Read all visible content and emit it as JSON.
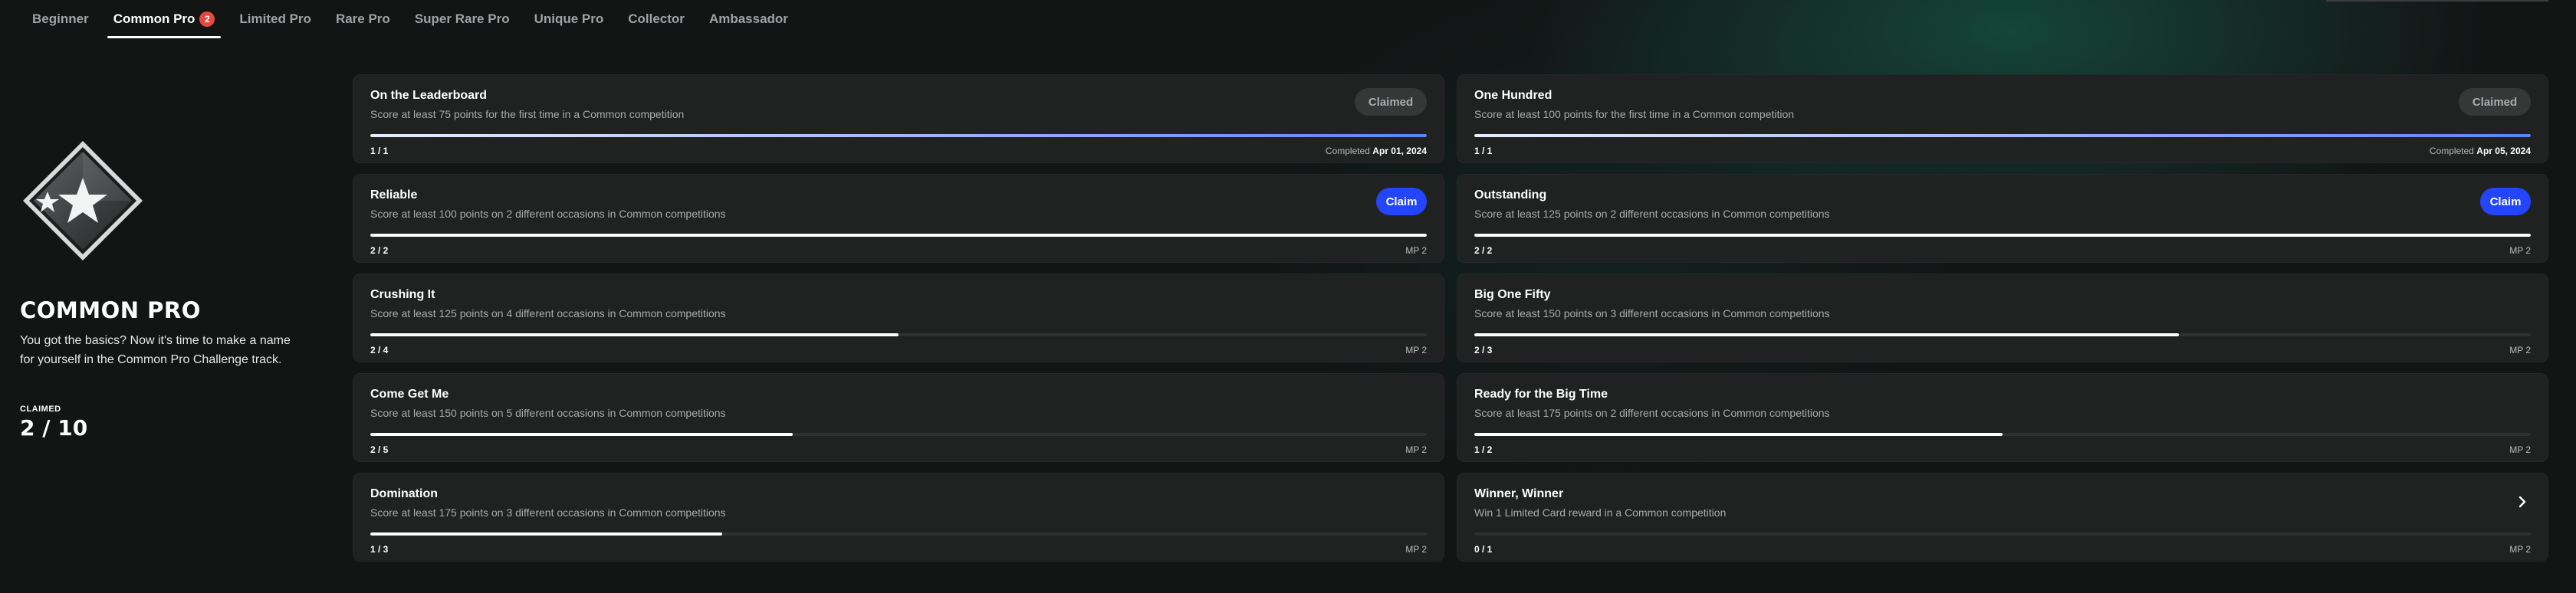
{
  "tabs": [
    {
      "label": "Beginner"
    },
    {
      "label": "Common Pro",
      "badge": "2",
      "active": true
    },
    {
      "label": "Limited Pro"
    },
    {
      "label": "Rare Pro"
    },
    {
      "label": "Super Rare Pro"
    },
    {
      "label": "Unique Pro"
    },
    {
      "label": "Collector"
    },
    {
      "label": "Ambassador"
    }
  ],
  "track": {
    "title": "COMMON PRO",
    "description": "You got the basics? Now it's time to make a name for yourself in the Common Pro Challenge track.",
    "claimed_label": "CLAIMED",
    "claimed_value": "2 / 10",
    "emblem_icon": "star-diamond-emblem-icon"
  },
  "challenges": [
    {
      "title": "On the Leaderboard",
      "desc": "Score at least 75 points for the first time in a Common competition",
      "count": "1 / 1",
      "progress": 1.0,
      "status": "claimed",
      "button": "Claimed",
      "meta_prefix": "Completed ",
      "meta_value": "Apr 01, 2024"
    },
    {
      "title": "One Hundred",
      "desc": "Score at least 100 points for the first time in a Common competition",
      "count": "1 / 1",
      "progress": 1.0,
      "status": "claimed",
      "button": "Claimed",
      "meta_prefix": "Completed ",
      "meta_value": "Apr 05, 2024"
    },
    {
      "title": "Reliable",
      "desc": "Score at least 100 points on 2 different occasions in Common competitions",
      "count": "2 / 2",
      "progress": 1.0,
      "status": "claim",
      "button": "Claim",
      "meta_prefix": "",
      "meta_value": "MP 2"
    },
    {
      "title": "Outstanding",
      "desc": "Score at least 125 points on 2 different occasions in Common competitions",
      "count": "2 / 2",
      "progress": 1.0,
      "status": "claim",
      "button": "Claim",
      "meta_prefix": "",
      "meta_value": "MP 2"
    },
    {
      "title": "Crushing It",
      "desc": "Score at least 125 points on 4 different occasions in Common competitions",
      "count": "2 / 4",
      "progress": 0.5,
      "status": "progress",
      "button": "",
      "meta_prefix": "",
      "meta_value": "MP 2"
    },
    {
      "title": "Big One Fifty",
      "desc": "Score at least 150 points on 3 different occasions in Common competitions",
      "count": "2 / 3",
      "progress": 0.667,
      "status": "progress",
      "button": "",
      "meta_prefix": "",
      "meta_value": "MP 2"
    },
    {
      "title": "Come Get Me",
      "desc": "Score at least 150 points on 5 different occasions in Common competitions",
      "count": "2 / 5",
      "progress": 0.4,
      "status": "progress",
      "button": "",
      "meta_prefix": "",
      "meta_value": "MP 2"
    },
    {
      "title": "Ready for the Big Time",
      "desc": "Score at least 175 points on 2 different occasions in Common competitions",
      "count": "1 / 2",
      "progress": 0.5,
      "status": "progress",
      "button": "",
      "meta_prefix": "",
      "meta_value": "MP 2"
    },
    {
      "title": "Domination",
      "desc": "Score at least 175 points on 3 different occasions in Common competitions",
      "count": "1 / 3",
      "progress": 0.333,
      "status": "progress",
      "button": "",
      "meta_prefix": "",
      "meta_value": "MP 2"
    },
    {
      "title": "Winner, Winner",
      "desc": "Win 1 Limited Card reward in a Common competition",
      "count": "0 / 1",
      "progress": 0.0,
      "status": "locked",
      "button": "",
      "meta_prefix": "",
      "meta_value": "MP 2",
      "icon": "chevron-right-icon"
    }
  ],
  "colors": {
    "claim_button": "#2345ff",
    "badge": "#e5483f",
    "progress_done_end": "#5b83f5"
  }
}
